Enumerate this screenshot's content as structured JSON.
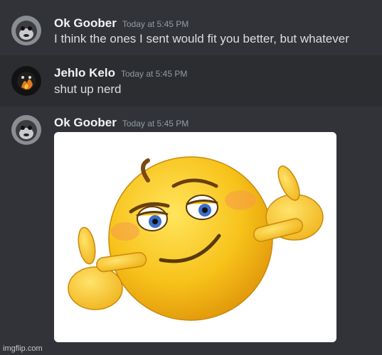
{
  "messages": [
    {
      "author": "Ok Goober",
      "timestamp": "Today at 5:45 PM",
      "text": "I think the ones I sent would fit you better, but whatever",
      "avatar_icon": "gorilla-avatar-icon"
    },
    {
      "author": "Jehlo Kelo",
      "timestamp": "Today at 5:45 PM",
      "text": "shut up nerd",
      "avatar_icon": "dark-fire-avatar-icon"
    },
    {
      "author": "Ok Goober",
      "timestamp": "Today at 5:45 PM",
      "attachment": "smug-pointing-emoji-image",
      "avatar_icon": "gorilla-avatar-icon"
    }
  ],
  "watermark": "imgflip.com",
  "colors": {
    "background": "#313338",
    "highlight": "#2b2d31",
    "username": "#f2f3f5",
    "timestamp": "#949ba4",
    "text": "#dbdee1",
    "emoji_yellow": "#f7c21a"
  }
}
